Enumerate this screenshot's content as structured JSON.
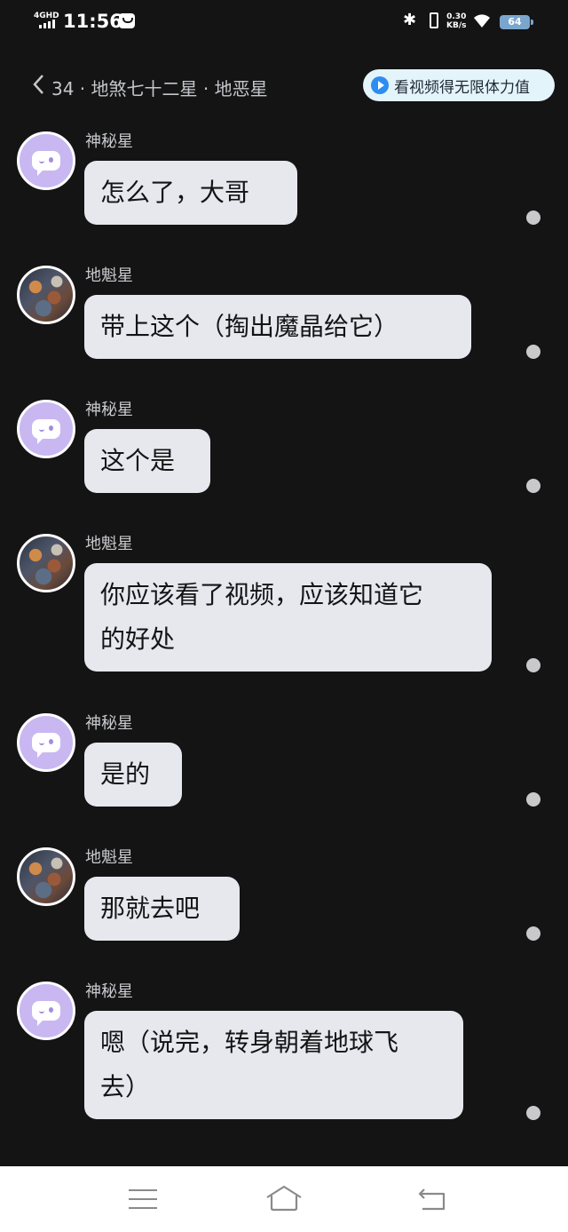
{
  "status_bar": {
    "network": "4GHD",
    "time": "11:56",
    "speed_value": "0.30",
    "speed_unit": "KB/s",
    "battery": "64",
    "icons": [
      "message-icon",
      "bluetooth-icon",
      "vibrate-icon",
      "wifi-icon",
      "battery-icon"
    ]
  },
  "header": {
    "chapter_title": "34 · 地煞七十二星 · 地恶星",
    "ad_button_label": "看视频得无限体力值"
  },
  "messages": [
    {
      "speaker": "神秘星",
      "text": "怎么了，大哥",
      "avatar": "mystery"
    },
    {
      "speaker": "地魁星",
      "text": "带上这个（掏出魔晶给它）",
      "avatar": "hero"
    },
    {
      "speaker": "神秘星",
      "text": "这个是",
      "avatar": "mystery"
    },
    {
      "speaker": "地魁星",
      "text_line1": "你应该看了视频，应该知道它",
      "text_line2": "的好处",
      "avatar": "hero"
    },
    {
      "speaker": "神秘星",
      "text": "是的",
      "avatar": "mystery"
    },
    {
      "speaker": "地魁星",
      "text": "那就去吧",
      "avatar": "hero"
    },
    {
      "speaker": "神秘星",
      "text_line1": "嗯（说完，转身朝着地球飞",
      "text_line2": "去）",
      "avatar": "mystery"
    }
  ],
  "colors": {
    "background": "#141415",
    "bubble": "#e6e8ee",
    "mystery_avatar": "#c9b7f2",
    "ad_button": "#e4f4fb",
    "ad_icon": "#2d8ef0"
  }
}
